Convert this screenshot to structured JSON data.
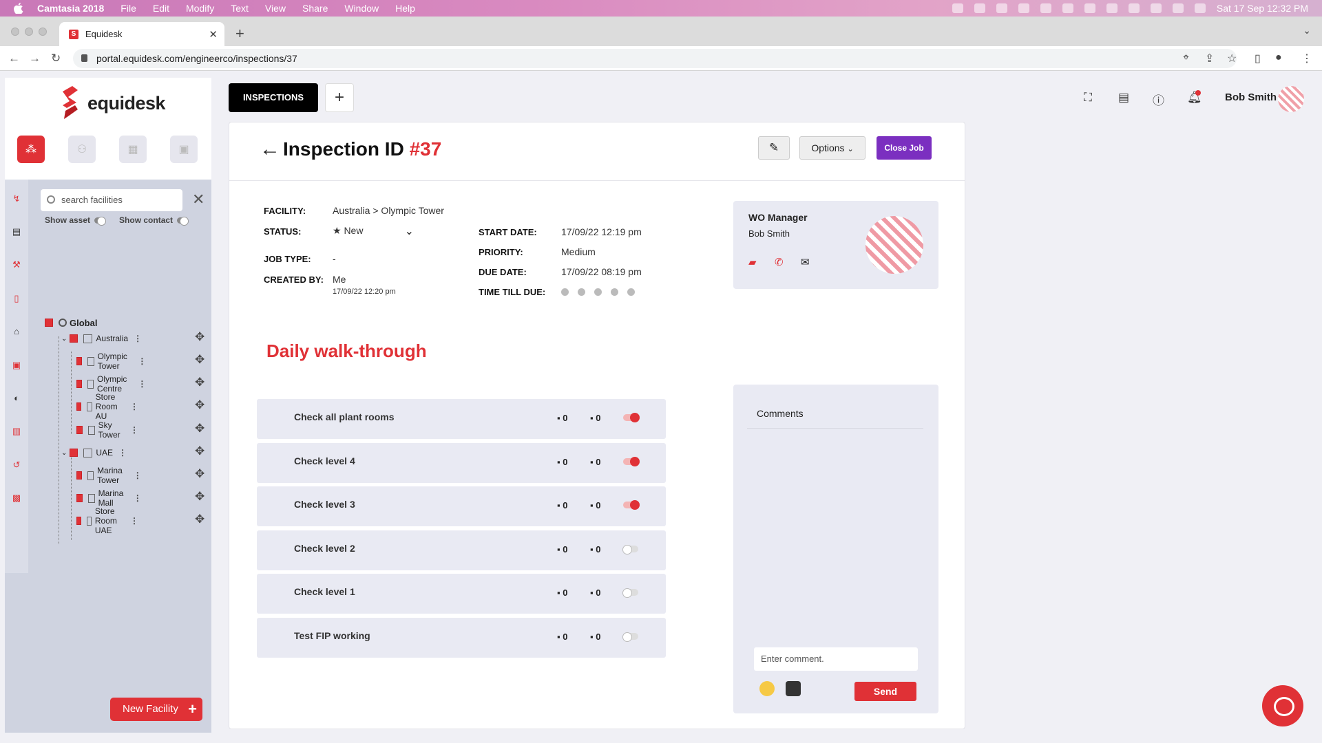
{
  "menubar": {
    "app": "Camtasia 2018",
    "menus": [
      "File",
      "Edit",
      "Modify",
      "Text",
      "View",
      "Share",
      "Window",
      "Help"
    ],
    "clock": "Sat 17 Sep  12:32 PM"
  },
  "browser": {
    "tab_title": "Equidesk",
    "url": "portal.equidesk.com/engineerco/inspections/37"
  },
  "brand": {
    "name": "equidesk"
  },
  "sidebar": {
    "search_placeholder": "search facilities",
    "show_asset": "Show asset",
    "show_contact": "Show contact",
    "tree": [
      "Global",
      "Australia",
      "Olympic Tower",
      "Olympic Centre",
      "Store Room AU",
      "Sky Tower",
      "UAE",
      "Marina Tower",
      "Marina Mall",
      "Store Room UAE"
    ],
    "new_facility": "New Facility"
  },
  "topbar": {
    "inspections": "INSPECTIONS",
    "user": "Bob Smith"
  },
  "header": {
    "title_prefix": "Inspection ID",
    "title_id": "#37",
    "options": "Options",
    "close_job": "Close Job"
  },
  "details": {
    "facility_label": "FACILITY:",
    "facility": "Australia > Olympic Tower",
    "status_label": "STATUS:",
    "status": "★ New",
    "job_type_label": "JOB TYPE:",
    "job_type": "-",
    "created_by_label": "CREATED BY:",
    "created_by": "Me",
    "created_at": "17/09/22 12:20 pm",
    "start_date_label": "START DATE:",
    "start_date": "17/09/22 12:19 pm",
    "priority_label": "PRIORITY:",
    "priority": "Medium",
    "due_date_label": "DUE DATE:",
    "due_date": "17/09/22 08:19 pm",
    "time_till_due_label": "TIME TILL DUE:"
  },
  "manager": {
    "title": "WO Manager",
    "name": "Bob Smith"
  },
  "section_title": "Daily walk-through",
  "tasks": [
    {
      "name": "Check all plant rooms",
      "comments": "0",
      "photos": "0",
      "done": true
    },
    {
      "name": "Check level 4",
      "comments": "0",
      "photos": "0",
      "done": true
    },
    {
      "name": "Check level 3",
      "comments": "0",
      "photos": "0",
      "done": true
    },
    {
      "name": "Check level 2",
      "comments": "0",
      "photos": "0",
      "done": false
    },
    {
      "name": "Check level 1",
      "comments": "0",
      "photos": "0",
      "done": false
    },
    {
      "name": "Test FIP working",
      "comments": "0",
      "photos": "0",
      "done": false
    }
  ],
  "comments": {
    "title": "Comments",
    "placeholder": "Enter comment.",
    "send": "Send"
  },
  "colors": {
    "accent": "#e03136",
    "close_job": "#7b2fc0"
  }
}
